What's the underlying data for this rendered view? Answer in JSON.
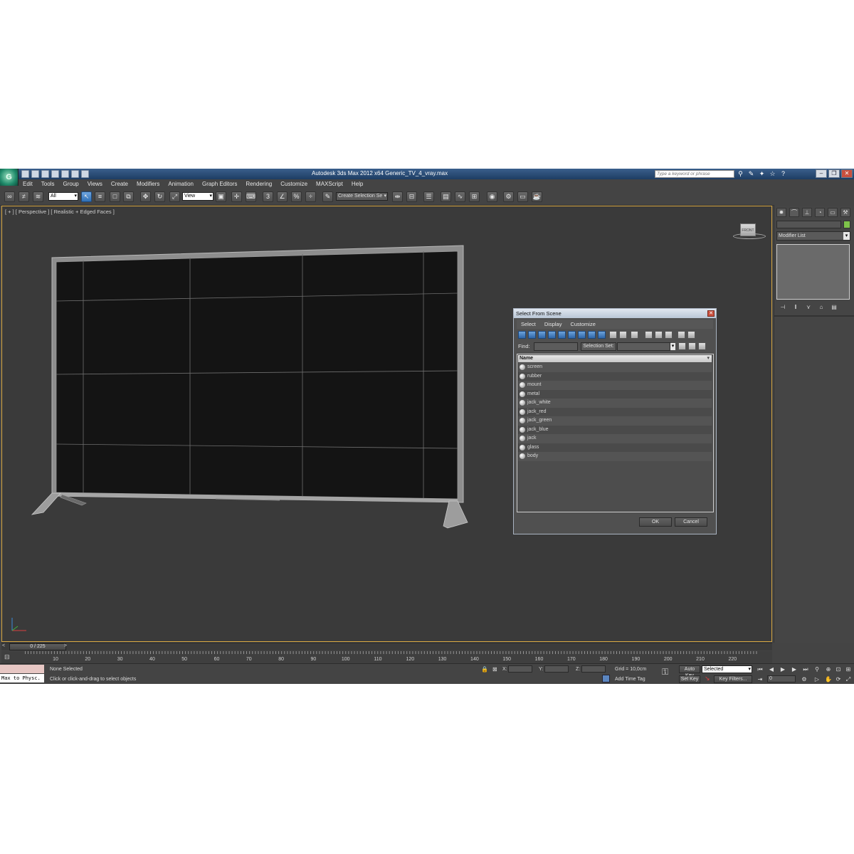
{
  "app": {
    "title": "Autodesk 3ds Max  2012 x64      Generic_TV_4_vray.max",
    "search_placeholder": "Type a keyword or phrase"
  },
  "menu": [
    "Edit",
    "Tools",
    "Group",
    "Views",
    "Create",
    "Modifiers",
    "Animation",
    "Graph Editors",
    "Rendering",
    "Customize",
    "MAXScript",
    "Help"
  ],
  "toolbar": {
    "filter_value": "All",
    "refcoord_value": "View",
    "selection_set_placeholder": "Create Selection Se"
  },
  "viewport": {
    "label": "[ + ] [ Perspective ] [ Realistic + Edged Faces ]",
    "viewcube_label": "FRONT"
  },
  "dialog": {
    "title": "Select From Scene",
    "menu": [
      "Select",
      "Display",
      "Customize"
    ],
    "find_label": "Find:",
    "selection_set_label": "Selection Set:",
    "column_header": "Name",
    "objects": [
      "screen",
      "rubber",
      "mount",
      "metal",
      "jack_white",
      "jack_red",
      "jack_green",
      "jack_blue",
      "jack",
      "glass",
      "body"
    ],
    "ok_label": "OK",
    "cancel_label": "Cancel"
  },
  "command_panel": {
    "modifier_list": "Modifier List",
    "object_color": "#7ec34a"
  },
  "timeline": {
    "frame_display": "0 / 225",
    "prev": "<",
    "next": ">",
    "ticks": [
      "10",
      "20",
      "30",
      "40",
      "50",
      "60",
      "70",
      "80",
      "90",
      "100",
      "110",
      "120",
      "130",
      "140",
      "150",
      "160",
      "170",
      "180",
      "190",
      "200",
      "210",
      "220"
    ]
  },
  "status": {
    "listener_text": "Max to Physc.",
    "selection_text": "None Selected",
    "prompt_text": "Click or click-and-drag to select objects",
    "x_label": "X:",
    "y_label": "Y:",
    "z_label": "Z:",
    "grid_text": "Grid = 10,0cm",
    "add_time_tag": "Add Time Tag",
    "auto_key": "Auto Key",
    "set_key": "Set Key",
    "selected_value": "Selected",
    "key_filters": "Key Filters...",
    "current_frame": "0"
  }
}
